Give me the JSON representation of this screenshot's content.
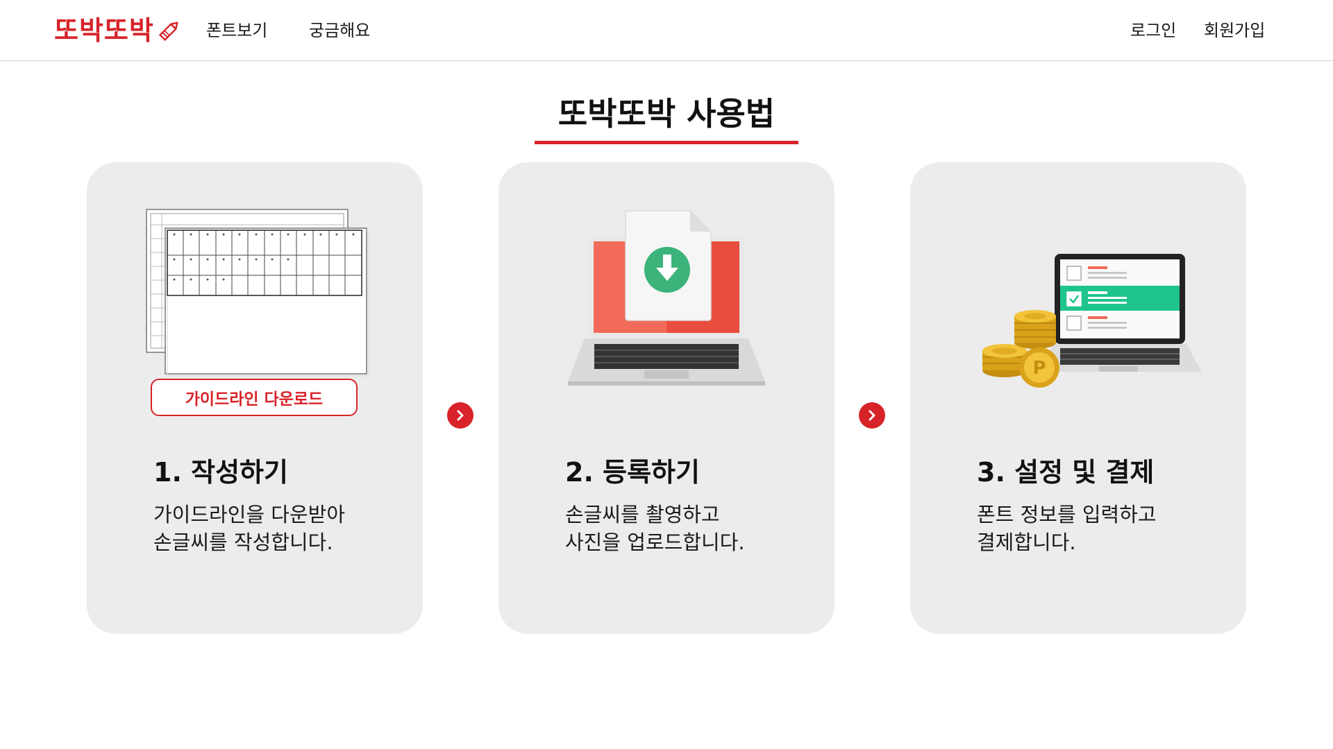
{
  "header": {
    "logo_text": "또박또박",
    "logo_icon": "pencil-icon",
    "nav": [
      {
        "label": "폰트보기"
      },
      {
        "label": "궁금해요"
      }
    ],
    "auth": {
      "login": "로그인",
      "signup": "회원가입"
    }
  },
  "main": {
    "title": "또박또박 사용법",
    "steps": [
      {
        "title": "1. 작성하기",
        "desc": [
          "가이드라인을 다운받아",
          "손글씨를 작성합니다."
        ],
        "button_label": "가이드라인 다운로드",
        "illustration": "guideline-sheets-image"
      },
      {
        "title": "2. 등록하기",
        "desc": [
          "손글씨를 촬영하고",
          "사진을 업로드합니다."
        ],
        "illustration": "laptop-download-image"
      },
      {
        "title": "3. 설정 및 결제",
        "desc": [
          "폰트 정보를 입력하고",
          "결제합니다."
        ],
        "illustration": "laptop-coins-image"
      }
    ]
  },
  "colors": {
    "accent": "#d8232a",
    "card_bg": "#ececec",
    "download_green": "#3cb37a",
    "check_green": "#1ec48c",
    "coin_gold": "#e9b522"
  }
}
